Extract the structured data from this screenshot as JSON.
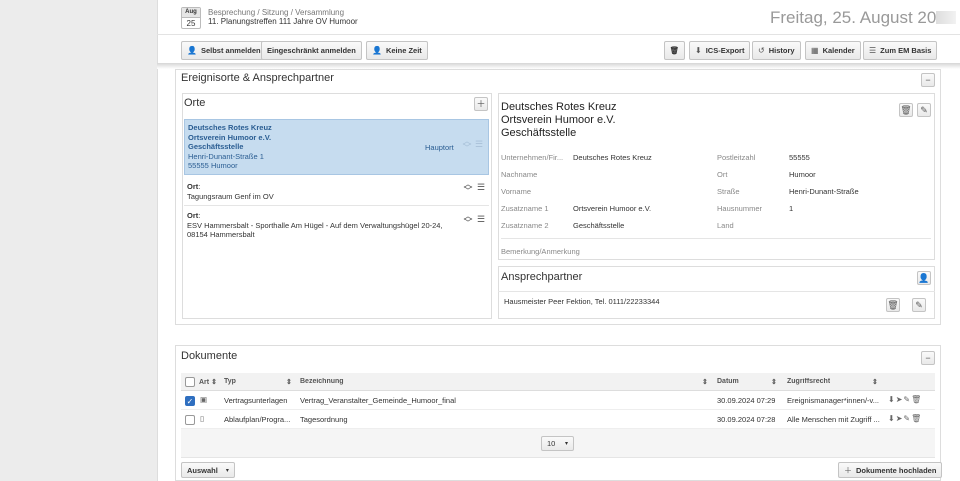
{
  "header": {
    "date_month": "Aug",
    "date_day": "25",
    "breadcrumb": "Besprechung / Sitzung / Versammlung",
    "event_title": "11. Planungstreffen 111 Jahre OV Humoor",
    "big_date": "Freitag, 25. August 20"
  },
  "toolbar": {
    "selbst_anmelden": "Selbst anmelden",
    "eingeschraenkt": "Eingeschränkt  anmelden",
    "keine_zeit": "Keine Zeit",
    "ics_export": "ICS-Export",
    "history": "History",
    "kalender": "Kalender",
    "zum_em_basis": "Zum EM Basis"
  },
  "ereignisorte": {
    "title": "Ereignisorte & Ansprechpartner",
    "orte_title": "Orte",
    "locations": [
      {
        "line1": "Deutsches Rotes Kreuz",
        "line2": "Ortsverein Humoor e.V.",
        "line3": "Geschäftsstelle",
        "line4": "Henri-Dunant-Straße 1",
        "line5": "55555 Humoor",
        "tag": "Hauptort"
      },
      {
        "label": "Ort",
        "line1": "Tagungsraum Genf im OV"
      },
      {
        "label": "Ort",
        "line1": "ESV Hammersbalt - Sporthalle Am Hügel - Auf dem Verwaltungshügel 20-24,",
        "line2": "08154 Hammersbalt"
      }
    ],
    "detail": {
      "title1": "Deutsches Rotes Kreuz",
      "title2": "Ortsverein Humoor e.V.",
      "title3": "Geschäftsstelle",
      "unternehmen_label": "Unternehmen/Fir...",
      "unternehmen": "Deutsches Rotes Kreuz",
      "nachname_label": "Nachname",
      "vorname_label": "Vorname",
      "zusatz1_label": "Zusatzname 1",
      "zusatz1": "Ortsverein Humoor e.V.",
      "zusatz2_label": "Zusatzname 2",
      "zusatz2": "Geschäftsstelle",
      "plz_label": "Postleitzahl",
      "plz": "55555",
      "ort_label": "Ort",
      "ort": "Humoor",
      "strasse_label": "Straße",
      "strasse": "Henri-Dunant-Straße",
      "hausnummer_label": "Hausnummer",
      "hausnummer": "1",
      "land_label": "Land",
      "bemerkung_label": "Bemerkung/Anmerkung"
    },
    "ansprechpartner_title": "Ansprechpartner",
    "ansprechpartner": "Hausmeister Peer Fektion, Tel. 0111/22233344"
  },
  "dokumente": {
    "title": "Dokumente",
    "columns": {
      "art": "Art",
      "typ": "Typ",
      "bezeichnung": "Bezeichnung",
      "datum": "Datum",
      "zugriff": "Zugriffsrecht"
    },
    "rows": [
      {
        "typ": "Vertragsunterlagen",
        "bezeichnung": "Vertrag_Veranstalter_Gemeinde_Humoor_final",
        "datum": "30.09.2024 07:29",
        "zugriff": "Ereignismanager*innen/-v..."
      },
      {
        "typ": "Ablaufplan/Progra...",
        "bezeichnung": "Tagesordnung",
        "datum": "30.09.2024 07:28",
        "zugriff": "Alle Menschen mit Zugriff ..."
      }
    ],
    "page_size": "10",
    "auswahl": "Auswahl",
    "upload": "Dokumente hochladen"
  }
}
